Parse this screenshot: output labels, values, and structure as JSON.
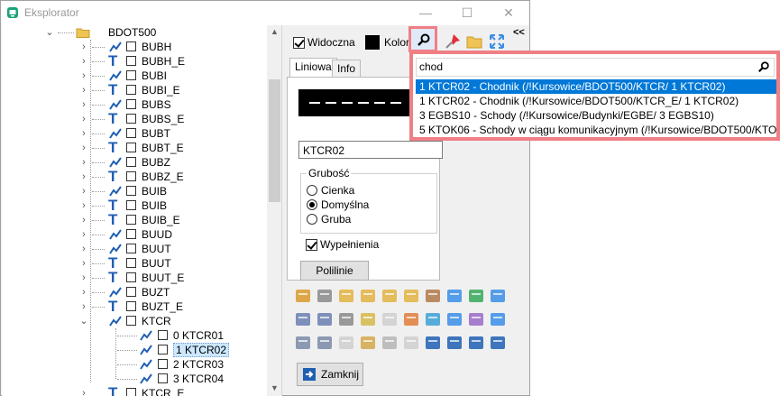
{
  "window": {
    "title": "Eksplorator",
    "minimize": "—",
    "maximize": "☐",
    "close": "✕"
  },
  "tree": {
    "root": "BDOT500",
    "items": [
      {
        "type": "line",
        "label": "BUBH"
      },
      {
        "type": "text",
        "label": "BUBH_E"
      },
      {
        "type": "line",
        "label": "BUBI"
      },
      {
        "type": "text",
        "label": "BUBI_E"
      },
      {
        "type": "line",
        "label": "BUBS"
      },
      {
        "type": "text",
        "label": "BUBS_E"
      },
      {
        "type": "line",
        "label": "BUBT"
      },
      {
        "type": "text",
        "label": "BUBT_E"
      },
      {
        "type": "line",
        "label": "BUBZ"
      },
      {
        "type": "text",
        "label": "BUBZ_E"
      },
      {
        "type": "line",
        "label": "BUIB"
      },
      {
        "type": "text",
        "label": "BUIB"
      },
      {
        "type": "text",
        "label": "BUIB_E"
      },
      {
        "type": "line",
        "label": "BUUD"
      },
      {
        "type": "line",
        "label": "BUUT"
      },
      {
        "type": "text",
        "label": "BUUT"
      },
      {
        "type": "text",
        "label": "BUUT_E"
      },
      {
        "type": "line",
        "label": "BUZT"
      },
      {
        "type": "text",
        "label": "BUZT_E"
      }
    ],
    "expanded": {
      "label": "KTCR"
    },
    "children": [
      {
        "label": "0 KTCR01",
        "selected": false
      },
      {
        "label": "1 KTCR02",
        "selected": true
      },
      {
        "label": "2 KTCR03",
        "selected": false
      },
      {
        "label": "3 KTCR04",
        "selected": false
      }
    ],
    "last_partial": "KTCR_E"
  },
  "panel": {
    "visible_label": "Widoczna",
    "color_label": "Kolor",
    "collapse_label": "<<",
    "tabs": [
      "Liniowa",
      "Info"
    ],
    "name_value": "KTCR02",
    "thickness": {
      "title": "Grubość",
      "options": [
        "Cienka",
        "Domyślna",
        "Gruba"
      ],
      "selected": "Domyślna"
    },
    "fill_label": "Wypełnienia",
    "polylines_button": "Polilinie",
    "close_button": "Zamknij"
  },
  "search_popup": {
    "query": "chod",
    "results": [
      "1 KTCR02 - Chodnik (/!Kursowice/BDOT500/KTCR/ 1 KTCR02)",
      "1 KTCR02 - Chodnik (/!Kursowice/BDOT500/KTCR_E/ 1 KTCR02)",
      "3 EGBS10 - Schody (/!Kursowice/Budynki/EGBE/ 3 EGBS10)",
      "5 KTOK06 - Schody w ciągu komunikacyjnym (/!Kursowice/BDOT500/KTOK"
    ],
    "selected_index": 0
  },
  "colors": {
    "highlight": "#f07f85",
    "selection": "#0078d7",
    "tree_selection": "#cce8ff"
  }
}
